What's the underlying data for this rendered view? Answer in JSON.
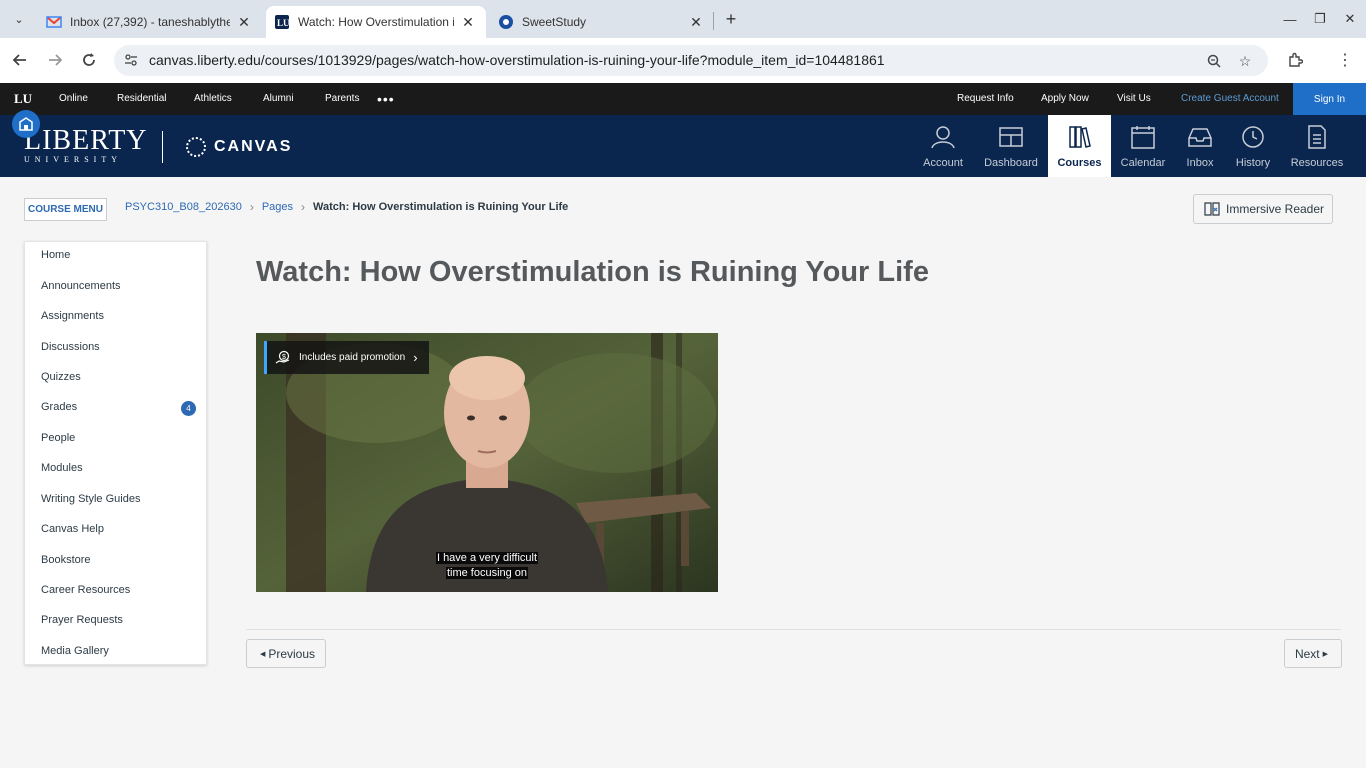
{
  "browser": {
    "tabs": [
      {
        "title": "Inbox (27,392) - taneshablythe",
        "favicon": "gmail-icon"
      },
      {
        "title": "Watch: How Overstimulation is",
        "favicon": "liberty-icon"
      },
      {
        "title": "SweetStudy",
        "favicon": "sweetstudy-icon"
      }
    ],
    "url": "canvas.liberty.edu/courses/1013929/pages/watch-how-overstimulation-is-ruining-your-life?module_item_id=104481861"
  },
  "lu_topbar": {
    "logo": "LU",
    "links": [
      "Online",
      "Residential",
      "Athletics",
      "Alumni",
      "Parents"
    ],
    "more": "•••",
    "right_links": [
      "Request Info",
      "Apply Now",
      "Visit Us"
    ],
    "guest": "Create Guest Account",
    "signin": "Sign In"
  },
  "header": {
    "liberty_big": "LIBERTY",
    "liberty_small": "UNIVERSITY",
    "canvas": "CANVAS",
    "nav": [
      "Account",
      "Dashboard",
      "Courses",
      "Calendar",
      "Inbox",
      "History",
      "Resources"
    ],
    "active_nav": "Courses"
  },
  "course": {
    "menu_button": "COURSE MENU",
    "breadcrumb": [
      "PSYC310_B08_202630",
      "Pages",
      "Watch: How Overstimulation is Ruining Your Life"
    ],
    "immersive_reader": "Immersive Reader",
    "sidebar": [
      "Home",
      "Announcements",
      "Assignments",
      "Discussions",
      "Quizzes",
      "Grades",
      "People",
      "Modules",
      "Writing Style Guides",
      "Canvas Help",
      "Bookstore",
      "Career Resources",
      "Prayer Requests",
      "Media Gallery"
    ],
    "grades_badge": "4"
  },
  "page": {
    "title": "Watch: How Overstimulation is Ruining Your Life",
    "video": {
      "promo": "Includes paid promotion",
      "caption_line1": "I have a very difficult",
      "caption_line2": "time focusing on"
    },
    "previous": "Previous",
    "next": "Next"
  }
}
